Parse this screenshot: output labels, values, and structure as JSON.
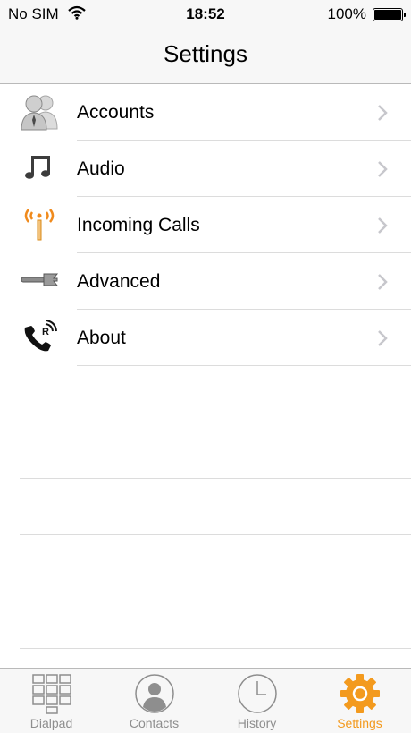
{
  "status_bar": {
    "carrier": "No SIM",
    "time": "18:52",
    "battery": "100%"
  },
  "nav": {
    "title": "Settings"
  },
  "settings_items": [
    {
      "label": "Accounts",
      "icon": "accounts-icon"
    },
    {
      "label": "Audio",
      "icon": "music-note-icon"
    },
    {
      "label": "Incoming Calls",
      "icon": "antenna-icon"
    },
    {
      "label": "Advanced",
      "icon": "wrench-icon"
    },
    {
      "label": "About",
      "icon": "phone-icon"
    }
  ],
  "tabbar": {
    "tabs": [
      {
        "label": "Dialpad",
        "icon": "dialpad-icon"
      },
      {
        "label": "Contacts",
        "icon": "contacts-icon"
      },
      {
        "label": "History",
        "icon": "clock-icon"
      },
      {
        "label": "Settings",
        "icon": "gear-icon"
      }
    ],
    "active": "Settings",
    "active_color": "#f39a1e",
    "inactive_color": "#8e8e8e"
  }
}
